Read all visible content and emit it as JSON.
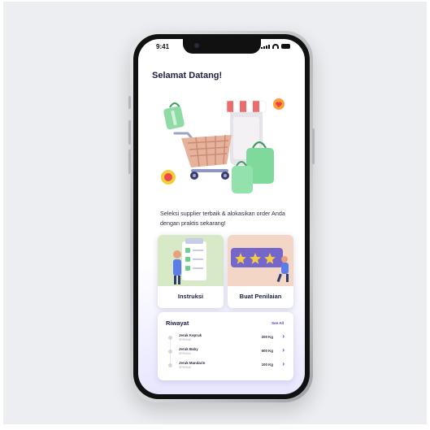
{
  "status_bar": {
    "time": "9:41"
  },
  "home": {
    "greeting": "Selamat Datang!",
    "tagline": "Seleksi supplier terbaik & alokasikan order Anda dengan praktis sekarang!"
  },
  "menu_cards": [
    {
      "label": "Instruksi",
      "icon": "checklist-illustration"
    },
    {
      "label": "Buat Penilaian",
      "icon": "star-rating-illustration"
    }
  ],
  "history": {
    "title": "Riwayat",
    "see_all": "See All",
    "items": [
      {
        "name": "Jeruk Kepruk",
        "sub": "SPK0042",
        "qty": "200 Kg"
      },
      {
        "name": "Jeruk Baby",
        "sub": "SPK0041",
        "qty": "500 Kg"
      },
      {
        "name": "Jeruk Mandarin",
        "sub": "SPK0040",
        "qty": "100 Kg"
      }
    ]
  },
  "colors": {
    "accent": "#4a3fd1",
    "title": "#1b2140",
    "green": "#7fd99b",
    "cart": "#dba58f"
  }
}
